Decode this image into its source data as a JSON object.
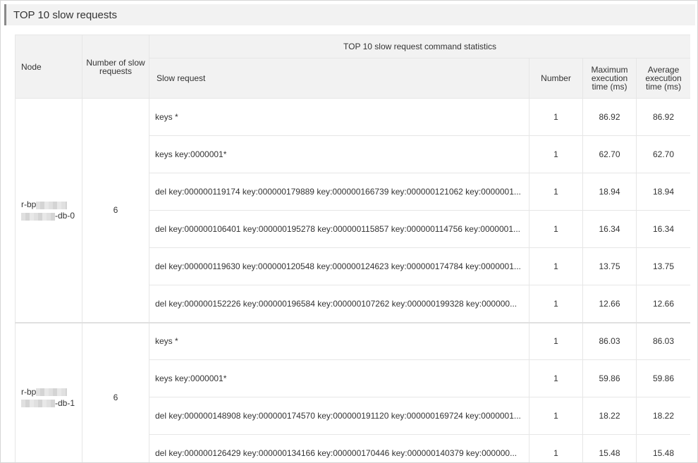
{
  "section": {
    "title": "TOP 10 slow requests"
  },
  "table": {
    "headers": {
      "node": "Node",
      "count": "Number of slow requests",
      "group": "TOP 10 slow request command statistics",
      "request": "Slow request",
      "number": "Number",
      "max": "Maximum execution time (ms)",
      "avg": "Average execution time (ms)"
    },
    "groups": [
      {
        "node_prefix": "r-bp",
        "node_suffix": "-db-0",
        "count": "6",
        "rows": [
          {
            "request": "keys *",
            "number": "1",
            "max": "86.92",
            "avg": "86.92"
          },
          {
            "request": "keys key:0000001*",
            "number": "1",
            "max": "62.70",
            "avg": "62.70"
          },
          {
            "request": "del key:000000119174 key:000000179889 key:000000166739 key:000000121062 key:0000001...",
            "number": "1",
            "max": "18.94",
            "avg": "18.94"
          },
          {
            "request": "del key:000000106401 key:000000195278 key:000000115857 key:000000114756 key:0000001...",
            "number": "1",
            "max": "16.34",
            "avg": "16.34"
          },
          {
            "request": "del key:000000119630 key:000000120548 key:000000124623 key:000000174784 key:0000001...",
            "number": "1",
            "max": "13.75",
            "avg": "13.75"
          },
          {
            "request": "del key:000000152226 key:000000196584 key:000000107262 key:000000199328 key:000000...",
            "number": "1",
            "max": "12.66",
            "avg": "12.66"
          }
        ]
      },
      {
        "node_prefix": "r-bp",
        "node_suffix": "-db-1",
        "count": "6",
        "rows": [
          {
            "request": "keys *",
            "number": "1",
            "max": "86.03",
            "avg": "86.03"
          },
          {
            "request": "keys key:0000001*",
            "number": "1",
            "max": "59.86",
            "avg": "59.86"
          },
          {
            "request": "del key:000000148908 key:000000174570 key:000000191120 key:000000169724 key:0000001...",
            "number": "1",
            "max": "18.22",
            "avg": "18.22"
          },
          {
            "request": "del key:000000126429 key:000000134166 key:000000170446 key:000000140379 key:000000...",
            "number": "1",
            "max": "15.48",
            "avg": "15.48"
          }
        ]
      }
    ]
  }
}
